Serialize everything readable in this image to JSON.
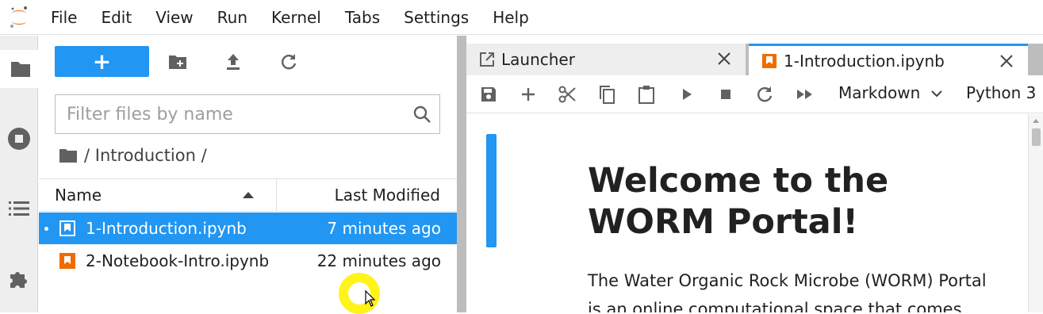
{
  "menu": [
    "File",
    "Edit",
    "View",
    "Run",
    "Kernel",
    "Tabs",
    "Settings",
    "Help"
  ],
  "filebrowser": {
    "new_label": "+",
    "filter_placeholder": "Filter files by name",
    "breadcrumb": "/ Introduction /",
    "columns": {
      "name": "Name",
      "modified": "Last Modified"
    },
    "files": [
      {
        "name": "1-Introduction.ipynb",
        "modified": "7 minutes ago",
        "selected": true
      },
      {
        "name": "2-Notebook-Intro.ipynb",
        "modified": "22 minutes ago",
        "selected": false
      }
    ]
  },
  "tabs": [
    {
      "label": "Launcher",
      "icon": "launcher-icon",
      "active": false
    },
    {
      "label": "1-Introduction.ipynb",
      "icon": "notebook-icon",
      "active": true
    }
  ],
  "notebook_toolbar": {
    "cell_type": "Markdown",
    "kernel": "Python 3"
  },
  "notebook": {
    "heading": "Welcome to the WORM Portal!",
    "paragraph": "The Water Organic Rock Microbe (WORM) Portal is an online computational space that comes"
  },
  "colors": {
    "accent": "#2196f3",
    "notebook_orange": "#ef6c00",
    "logo_orange": "#f37726"
  }
}
